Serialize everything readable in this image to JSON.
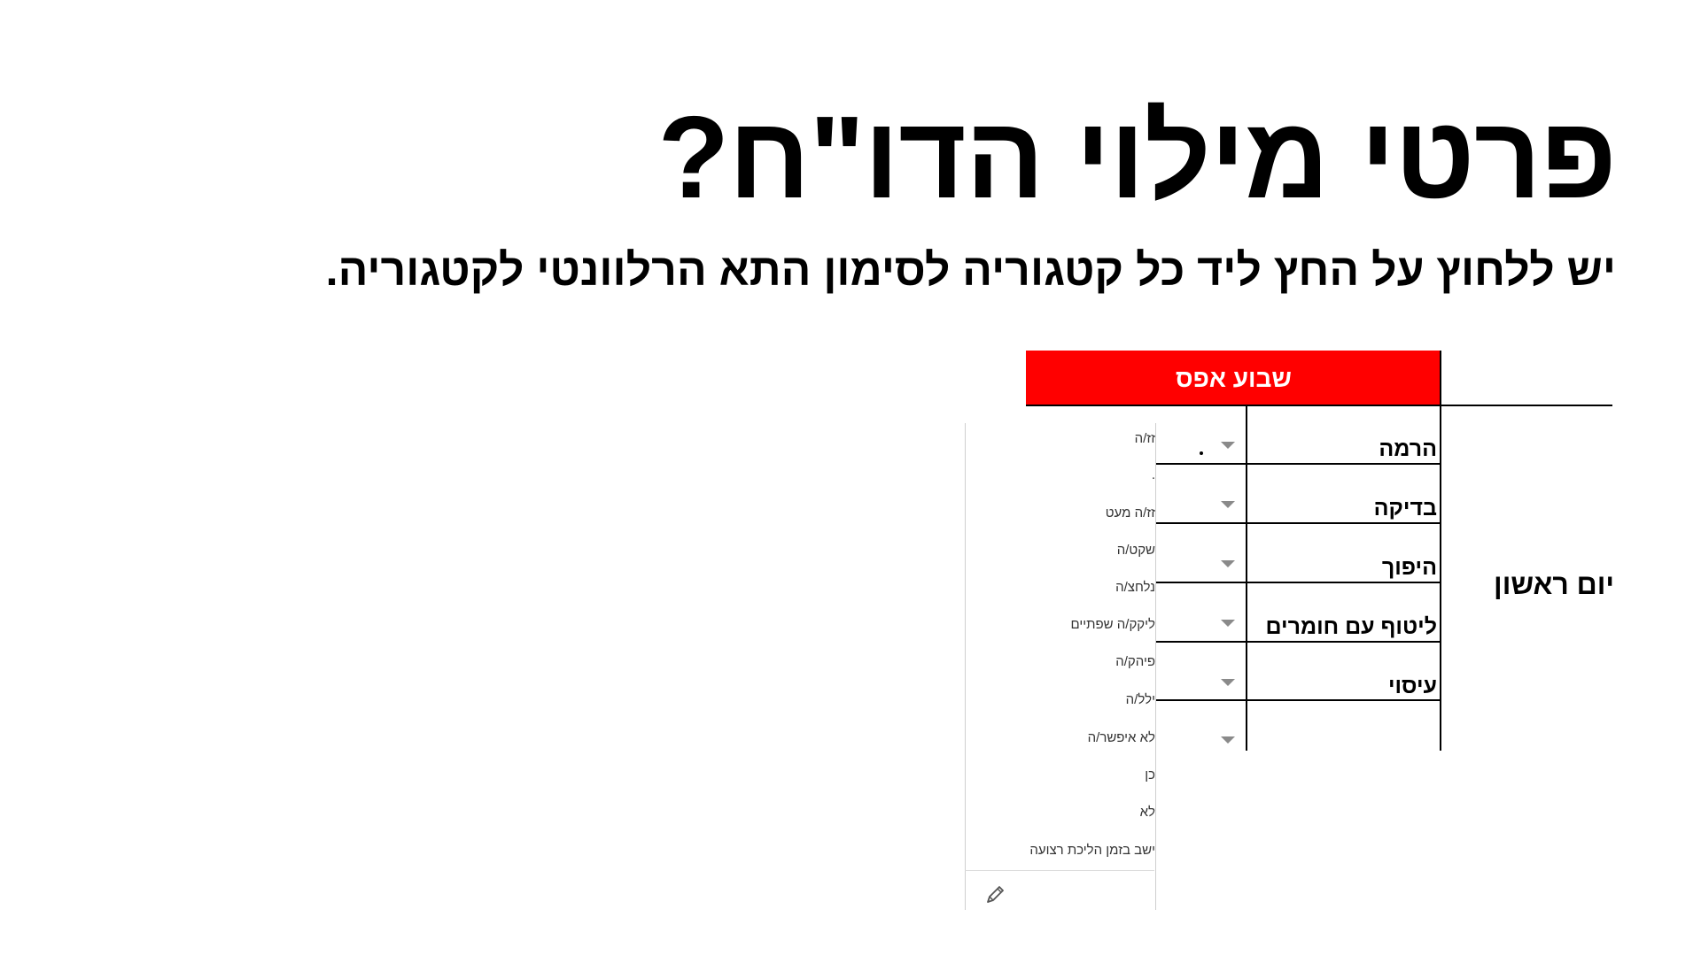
{
  "slide": {
    "title": "פרטי מילוי הדו\"ח?",
    "subtitle": "יש ללחוץ על החץ ליד כל קטגוריה לסימון התא הרלוונטי לקטגוריה."
  },
  "sheet": {
    "week_header": "שבוע אפס",
    "day_label": "יום ראשון",
    "categories": [
      "הרמה",
      "בדיקה",
      "היפוך",
      "ליטוף עם חומרים",
      "עיסוי"
    ],
    "header_color": "#ff0000"
  },
  "dropdown": {
    "options": [
      "זז/ה",
      ".",
      "זז/ה מעט",
      "שקט/ה",
      "נלחצ/ה",
      "ליקק/ה שפתיים",
      "פיהק/ה",
      "ילל/ה",
      "לא איפשר/ה",
      "כן",
      "לא",
      "ישב בזמן הליכת רצועה"
    ],
    "edit_icon": "pencil-icon"
  }
}
